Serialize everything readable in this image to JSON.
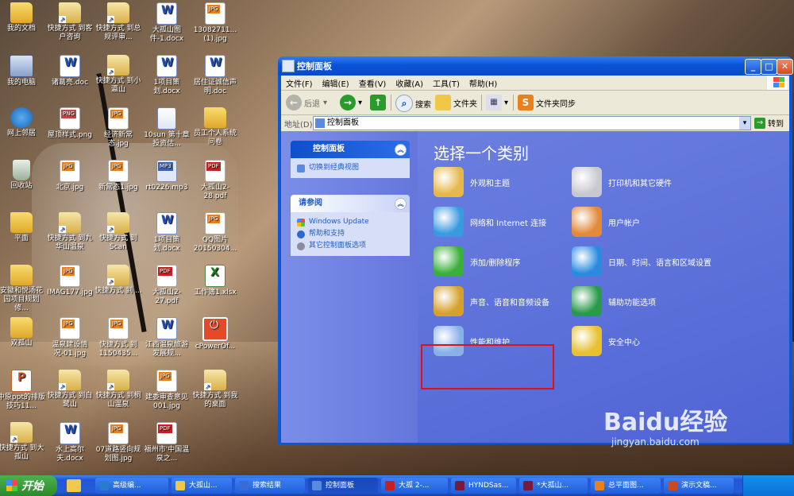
{
  "desktop": {
    "icons": [
      {
        "label": "我的文档",
        "kind": "folder"
      },
      {
        "label": "快捷方式 到客户咨询",
        "kind": "folder2"
      },
      {
        "label": "快捷方式 到总规评审...",
        "kind": "folder2"
      },
      {
        "label": "大孤山图件-1.docx",
        "kind": "word"
      },
      {
        "label": "13082711...(1).jpg",
        "kind": "jpg"
      },
      {
        "label": "我的电脑",
        "kind": "pc"
      },
      {
        "label": "诸葛亮.doc",
        "kind": "word"
      },
      {
        "label": "快捷方式 到小瀛山",
        "kind": "folder2"
      },
      {
        "label": "1项目策划.docx",
        "kind": "word"
      },
      {
        "label": "居住证诚信声明.doc",
        "kind": "word"
      },
      {
        "label": "网上邻居",
        "kind": "net"
      },
      {
        "label": "屋顶样式.png",
        "kind": "png"
      },
      {
        "label": "经济新常态.jpg",
        "kind": "jpg"
      },
      {
        "label": "10sun 第十章投资估...",
        "kind": "doc"
      },
      {
        "label": "员工个人系统问卷",
        "kind": "folder"
      },
      {
        "label": "回收站",
        "kind": "bin"
      },
      {
        "label": "北京.jpg",
        "kind": "jpg"
      },
      {
        "label": "新常态1.jpg",
        "kind": "jpg"
      },
      {
        "label": "rt0226.mp3",
        "kind": "mp3"
      },
      {
        "label": "大孤山2-28.pdf",
        "kind": "pdf"
      },
      {
        "label": "平面",
        "kind": "folder"
      },
      {
        "label": "快捷方式 到九华山温泉",
        "kind": "folder2"
      },
      {
        "label": "快捷方式 到Scan",
        "kind": "folder2"
      },
      {
        "label": "1项目策划.docx",
        "kind": "word"
      },
      {
        "label": "QQ图片20150304...",
        "kind": "jpg"
      },
      {
        "label": "安徽和悦汤花园项目规划修...",
        "kind": "folder"
      },
      {
        "label": "IMAG177.jpg",
        "kind": "jpg"
      },
      {
        "label": "快捷方式 到 ...",
        "kind": "folder2"
      },
      {
        "label": "大孤山2-27.pdf",
        "kind": "pdf"
      },
      {
        "label": "工作簿1.xlsx",
        "kind": "xls"
      },
      {
        "label": "双孤山",
        "kind": "folder"
      },
      {
        "label": "温泉建设情况-01.jpg",
        "kind": "jpg"
      },
      {
        "label": "快捷方式 到1150435...",
        "kind": "jpg"
      },
      {
        "label": "江西温泉旅游发展规...",
        "kind": "word"
      },
      {
        "label": "cPowerOf...",
        "kind": "power"
      },
      {
        "label": "中原ppt的排版技巧11...",
        "kind": "ppt"
      },
      {
        "label": "快捷方式 到白鹭山",
        "kind": "folder2"
      },
      {
        "label": "快捷方式 到桐山温泉",
        "kind": "folder2"
      },
      {
        "label": "建委审查意见 001.jpg",
        "kind": "jpg"
      },
      {
        "label": "快捷方式 到我的桌面",
        "kind": "folder2"
      },
      {
        "label": "快捷方式 到大孤山",
        "kind": "folder2"
      },
      {
        "label": "水上高尔夫.docx",
        "kind": "word"
      },
      {
        "label": "07道路竖向规划图.jpg",
        "kind": "jpg"
      },
      {
        "label": "福州市'中国温泉之...",
        "kind": "pdf"
      }
    ]
  },
  "window": {
    "title": "控制面板",
    "buttons": {
      "min": "_",
      "max": "□",
      "close": "✕"
    },
    "menu": [
      "文件(F)",
      "编辑(E)",
      "查看(V)",
      "收藏(A)",
      "工具(T)",
      "帮助(H)"
    ],
    "toolbar": {
      "back": "后退",
      "search": "搜索",
      "folders": "文件夹",
      "sync": "文件夹同步"
    },
    "address": {
      "label": "地址(D)",
      "value": "控制面板",
      "go": "转到"
    },
    "task_pane": {
      "control_panel": {
        "title": "控制面板",
        "switch": "切换到经典视图"
      },
      "see_also": {
        "title": "请参阅",
        "items": [
          "Windows Update",
          "帮助和支持",
          "其它控制面板选项"
        ]
      }
    },
    "main": {
      "title": "选择一个类别",
      "categories": [
        {
          "label": "外观和主题",
          "icon": "appearance-icon"
        },
        {
          "label": "打印机和其它硬件",
          "icon": "printer-icon"
        },
        {
          "label": "网络和 Internet 连接",
          "icon": "network-icon"
        },
        {
          "label": "用户帐户",
          "icon": "users-icon"
        },
        {
          "label": "添加/删除程序",
          "icon": "add-remove-icon"
        },
        {
          "label": "日期、时间、语言和区域设置",
          "icon": "datetime-icon"
        },
        {
          "label": "声音、语音和音频设备",
          "icon": "sound-icon"
        },
        {
          "label": "辅助功能选项",
          "icon": "accessibility-icon"
        },
        {
          "label": "性能和维护",
          "icon": "performance-icon"
        },
        {
          "label": "安全中心",
          "icon": "security-shield-icon"
        }
      ]
    }
  },
  "taskbar": {
    "start": "开始",
    "tasks": [
      "高级编...",
      "大孤山...",
      "搜索结果",
      "控制面板",
      "大孤 2-...",
      "HYNDSas...",
      "*大孤山...",
      "总平面图...",
      "演示文稿..."
    ],
    "active_task": "控制面板"
  },
  "watermark": {
    "brand": "Baidu经验",
    "url": "jingyan.baidu.com"
  },
  "colors": {
    "xp_blue": "#0a56d6",
    "pane_blue": "#6576dc",
    "highlight_red": "#e21010",
    "start_green": "#3a9a3a"
  }
}
